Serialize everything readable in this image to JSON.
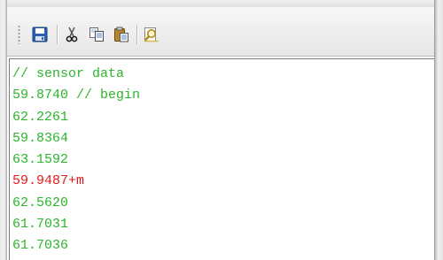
{
  "toolbar": {
    "buttons": [
      {
        "name": "save-icon",
        "tooltip": ""
      },
      {
        "name": "cut-icon",
        "tooltip": ""
      },
      {
        "name": "copy-icon",
        "tooltip": ""
      },
      {
        "name": "paste-icon",
        "tooltip": ""
      },
      {
        "name": "find-icon",
        "tooltip": ""
      }
    ]
  },
  "editor": {
    "lines": [
      {
        "text": "// sensor data",
        "color": "#2bb52b"
      },
      {
        "text": "59.8740 // begin",
        "color": "#2bb52b"
      },
      {
        "text": "62.2261",
        "color": "#2bb52b"
      },
      {
        "text": "59.8364",
        "color": "#2bb52b"
      },
      {
        "text": "63.1592",
        "color": "#2bb52b"
      },
      {
        "text": "59.9487+m",
        "color": "#e21a1a"
      },
      {
        "text": "62.5620",
        "color": "#2bb52b"
      },
      {
        "text": "61.7031",
        "color": "#2bb52b"
      },
      {
        "text": "61.7036",
        "color": "#2bb52b"
      }
    ]
  },
  "colors": {
    "valid_line": "#2bb52b",
    "error_line": "#e21a1a"
  }
}
